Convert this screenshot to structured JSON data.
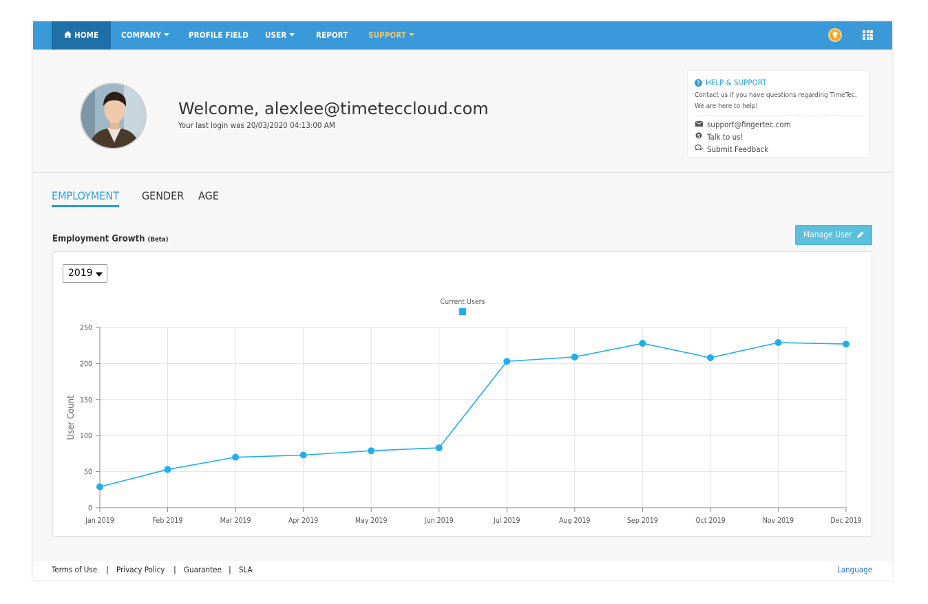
{
  "nav": {
    "home": "HOME",
    "company": "COMPANY",
    "profile_field": "PROFILE FIELD",
    "user": "USER",
    "report": "REPORT",
    "support": "SUPPORT",
    "active_color": "#1f6fa8",
    "bar_color": "#3a9ad9",
    "support_color": "#f5c36b"
  },
  "header": {
    "welcome": "Welcome, alexlee@timeteccloud.com",
    "last_login": "Your last login was 20/03/2020 04:13:00 AM"
  },
  "help": {
    "title": "HELP & SUPPORT",
    "desc": "Contact us if you have questions regarding TimeTec. We are here to help!",
    "email": "support@fingertec.com",
    "talk": "Talk to us!",
    "feedback": "Submit Feedback"
  },
  "tabs": {
    "employment": "EMPLOYMENT",
    "gender": "GENDER",
    "age": "AGE"
  },
  "section": {
    "title": "Employment Growth",
    "beta": "(Beta)",
    "manage_btn": "Manage User"
  },
  "year_select": {
    "value": "2019"
  },
  "chart_data": {
    "type": "line",
    "title": "",
    "legend": "Current Users",
    "legend_position": "top-center",
    "ylabel": "User Count",
    "xlabel": "",
    "ylim": [
      0,
      250
    ],
    "yticks": [
      0,
      50,
      100,
      150,
      200,
      250
    ],
    "grid": true,
    "color": "#1eaef0",
    "categories": [
      "Jan 2019",
      "Feb 2019",
      "Mar 2019",
      "Apr 2019",
      "May 2019",
      "Jun 2019",
      "Jul 2019",
      "Aug 2019",
      "Sep 2019",
      "Oct 2019",
      "Nov 2019",
      "Dec 2019"
    ],
    "series": [
      {
        "name": "Current Users",
        "values": [
          29,
          53,
          70,
          73,
          79,
          83,
          203,
          209,
          228,
          208,
          229,
          227
        ]
      }
    ]
  },
  "footer": {
    "terms": "Terms of Use",
    "privacy": "Privacy Policy",
    "guarantee": "Guarantee",
    "sla": "SLA",
    "language": "Language",
    "sep": "|"
  }
}
